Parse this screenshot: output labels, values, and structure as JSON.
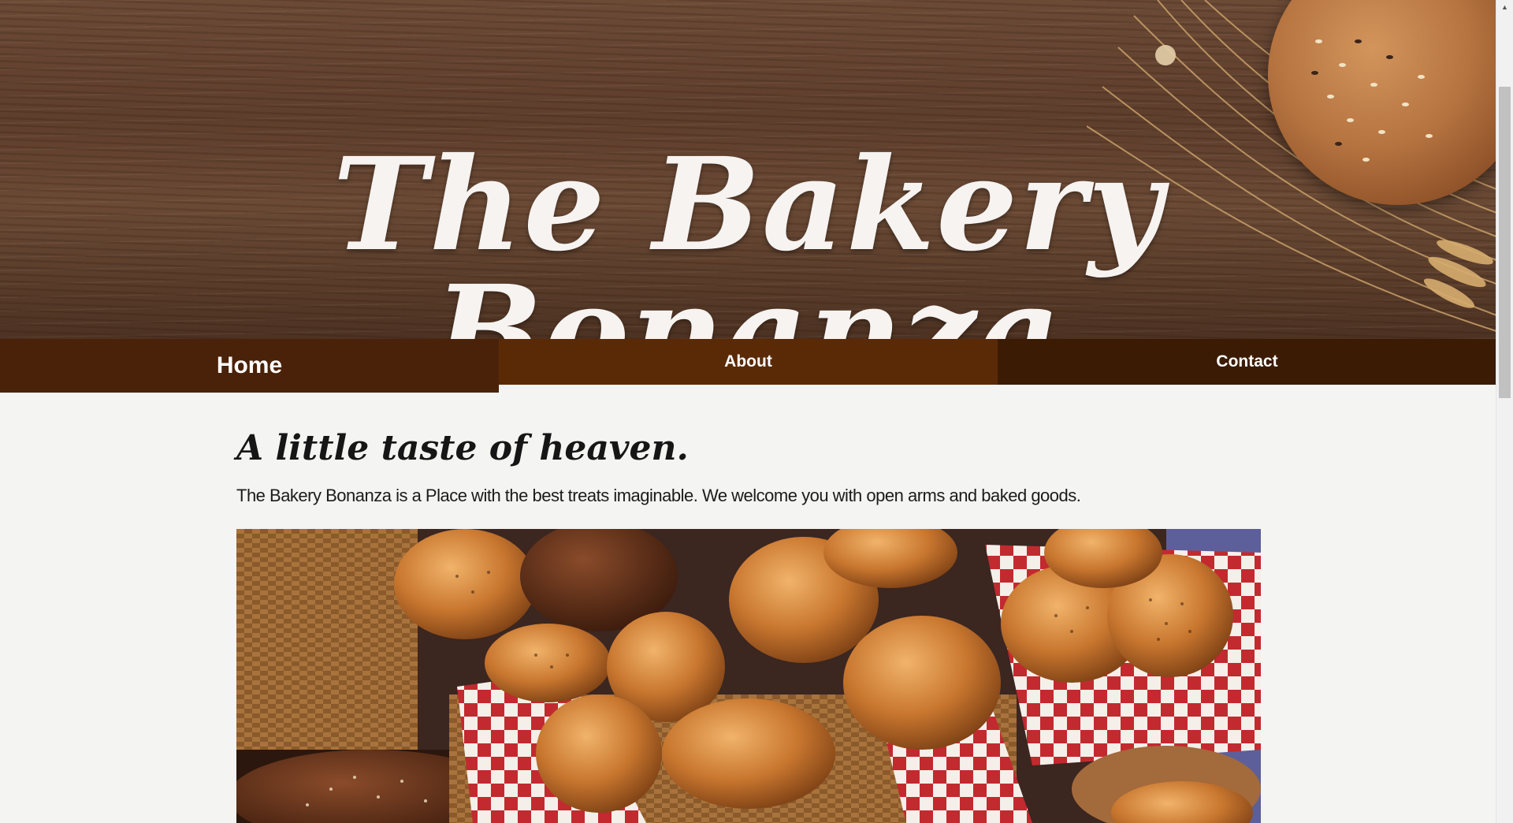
{
  "header": {
    "title": "The Bakery Bonanza"
  },
  "nav": {
    "items": [
      {
        "label": "Home",
        "active": true
      },
      {
        "label": "About"
      },
      {
        "label": "Contact"
      }
    ]
  },
  "main": {
    "tagline": "A little taste of heaven.",
    "intro": "The Bakery Bonanza is a Place with the best treats imaginable. We welcome you with open arms and baked goods."
  },
  "colors": {
    "nav_home": "#4a2209",
    "nav_about": "#5a2a07",
    "nav_contact": "#3b1b04",
    "page_background": "#f4f4f3"
  },
  "icons": {
    "scroll_up": "triangle-up-icon"
  }
}
